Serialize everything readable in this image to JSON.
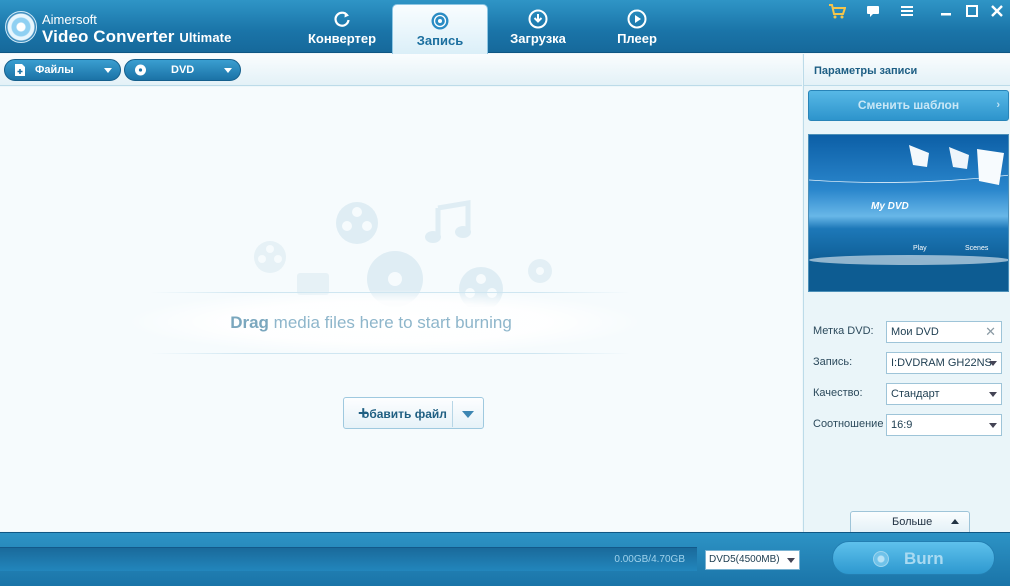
{
  "app": {
    "brand_top": "Aimersoft",
    "brand_main": "Video Converter",
    "brand_edition": "Ultimate"
  },
  "tabs": [
    {
      "label": "Конвертер",
      "icon": "refresh-icon",
      "active": false
    },
    {
      "label": "Запись",
      "icon": "disc-icon",
      "active": true
    },
    {
      "label": "Загрузка",
      "icon": "download-icon",
      "active": false
    },
    {
      "label": "Плеер",
      "icon": "play-icon",
      "active": false
    }
  ],
  "window_controls": {
    "cart": "cart-icon",
    "chat": "chat-icon",
    "menu": "menu-icon",
    "minimize": "minimize-icon",
    "maximize": "maximize-icon",
    "close": "close-icon"
  },
  "toolbar": {
    "files_label": "Файлы",
    "dvd_label": "DVD"
  },
  "droparea": {
    "drag_strong": "Drag",
    "drag_rest": " media files here to start burning",
    "add_file_label": "обавить файл"
  },
  "panel": {
    "title": "Параметры записи",
    "template_button": "Сменить шаблон",
    "preview": {
      "title": "My DVD",
      "play": "Play",
      "scenes": "Scenes"
    },
    "fields": {
      "dvd_label": {
        "label": "Метка DVD:",
        "value": "Мои DVD"
      },
      "burn_to": {
        "label": "Запись:",
        "value": "I:DVDRAM GH22NS"
      },
      "quality": {
        "label": "Качество:",
        "value": "Стандарт"
      },
      "ratio": {
        "label": "Соотношение",
        "value": "16:9"
      }
    },
    "more_label": "Больше"
  },
  "bottom": {
    "capacity_text": "0.00GB/4.70GB",
    "disc_type": "DVD5(4500MB)",
    "burn_label": "Burn"
  },
  "colors": {
    "accent": "#1a74a8",
    "active_tab_text": "#1c6f9f",
    "drag_text": "#8eb6cb"
  }
}
